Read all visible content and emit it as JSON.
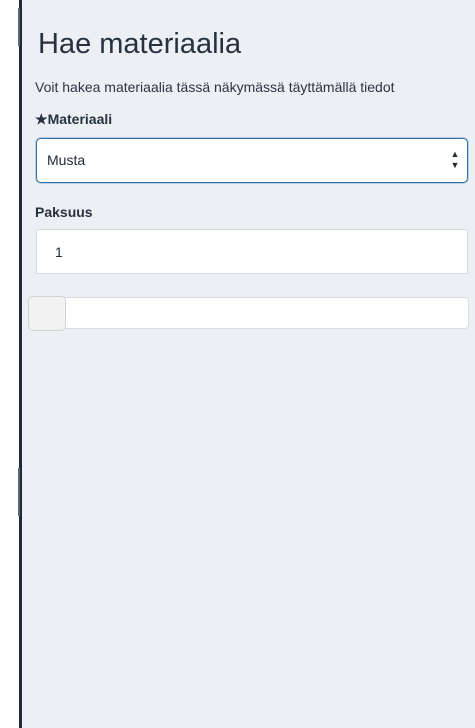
{
  "form": {
    "title": "Hae materiaalia",
    "subtitle": "Voit hakea materiaalia tässä näkymässä täyttämällä tiedot",
    "material": {
      "required_marker": "★",
      "label": "Materiaali",
      "selected_value": "Musta",
      "arrow_up": "▲",
      "arrow_down": "▼"
    },
    "thickness": {
      "label": "Paksuus",
      "value": "1",
      "slider_fraction": 0
    }
  }
}
